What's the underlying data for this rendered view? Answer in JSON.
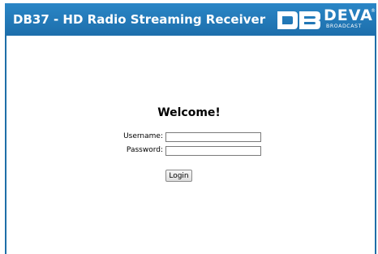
{
  "header": {
    "title": "DB37 - HD Radio Streaming Receiver",
    "logo_text": "DEVA",
    "logo_reg": "®",
    "logo_sub": "BROADCAST"
  },
  "login": {
    "welcome": "Welcome!",
    "username_label": "Username:",
    "username_value": "",
    "password_label": "Password:",
    "password_value": "",
    "button_label": "Login"
  },
  "colors": {
    "header_bg": "#1d6eab",
    "header_text": "#ffffff",
    "page_bg": "#ffffff"
  },
  "icons": {
    "logo_mark": "db-logo-icon"
  }
}
